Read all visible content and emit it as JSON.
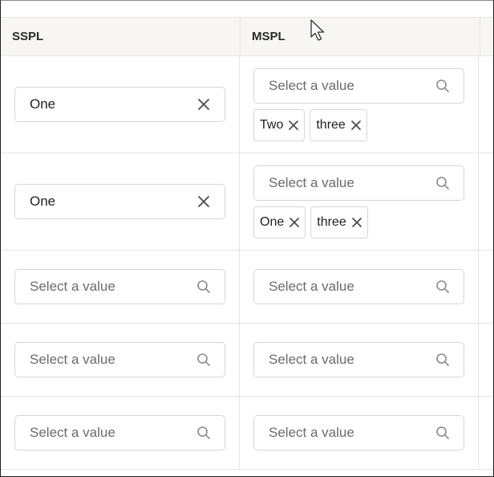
{
  "table": {
    "columns": [
      {
        "label": "SSPL"
      },
      {
        "label": "MSPL"
      }
    ],
    "rows": [
      {
        "sspl": {
          "value": "One",
          "placeholder": ""
        },
        "mspl": {
          "placeholder": "Select a value",
          "chips": [
            "Two",
            "three"
          ]
        }
      },
      {
        "sspl": {
          "value": "One",
          "placeholder": ""
        },
        "mspl": {
          "placeholder": "Select a value",
          "chips": [
            "One",
            "three"
          ]
        }
      },
      {
        "sspl": {
          "value": "",
          "placeholder": "Select a value"
        },
        "mspl": {
          "placeholder": "Select a value",
          "chips": []
        }
      },
      {
        "sspl": {
          "value": "",
          "placeholder": "Select a value"
        },
        "mspl": {
          "placeholder": "Select a value",
          "chips": []
        }
      },
      {
        "sspl": {
          "value": "",
          "placeholder": "Select a value"
        },
        "mspl": {
          "placeholder": "Select a value",
          "chips": []
        }
      }
    ]
  },
  "icons": {
    "clear": "close-icon",
    "search": "search-icon",
    "chip_remove": "close-icon",
    "cursor": "mouse-pointer-icon"
  },
  "colors": {
    "border": "#d8d6d4",
    "header_bg": "#f7f6f5",
    "placeholder": "#6b6b6b",
    "text": "#1f1f1f"
  }
}
